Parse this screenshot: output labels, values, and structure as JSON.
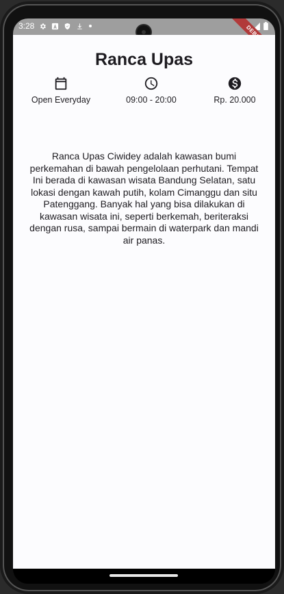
{
  "status_bar": {
    "time": "3:28",
    "icons": [
      "settings-icon",
      "a-icon",
      "shield-icon",
      "download-icon",
      "dot-icon"
    ],
    "right_icons": [
      "wifi-icon",
      "signal-icon",
      "battery-icon"
    ]
  },
  "debug_banner": "DEBUG",
  "page": {
    "title": "Ranca Upas",
    "info": [
      {
        "icon": "calendar-icon",
        "label": "Open Everyday"
      },
      {
        "icon": "clock-icon",
        "label": "09:00 - 20:00"
      },
      {
        "icon": "dollar-icon",
        "label": "Rp. 20.000"
      }
    ],
    "description": "Ranca Upas Ciwidey adalah kawasan bumi perkemahan di bawah pengelolaan perhutani. Tempat Ini berada di kawasan wisata Bandung Selatan, satu lokasi dengan kawah putih, kolam Cimanggu dan situ Patenggang. Banyak hal yang bisa dilakukan di kawasan wisata ini, seperti berkemah, beriteraksi dengan rusa, sampai bermain di waterpark dan mandi air panas."
  }
}
